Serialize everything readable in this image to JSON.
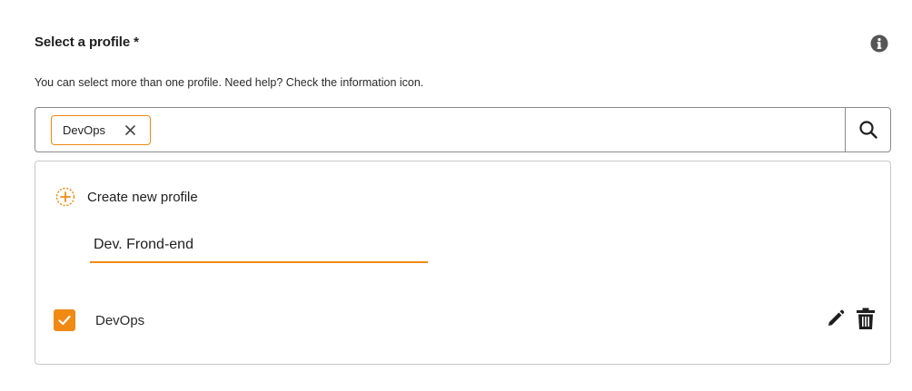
{
  "header": {
    "title": "Select a profile *",
    "subtitle": "You can select more than one profile. Need help? Check the information icon."
  },
  "selector": {
    "chips": [
      {
        "label": "DevOps"
      }
    ],
    "icons": {
      "chip_remove": "close-icon",
      "search": "search-icon",
      "info": "info-icon"
    }
  },
  "panel": {
    "create_label": "Create new profile",
    "new_profile_value": "Dev. Frond-end",
    "profiles": [
      {
        "label": "DevOps",
        "checked": true
      }
    ],
    "icons": {
      "create": "plus-circle-icon",
      "edit": "pencil-icon",
      "delete": "trash-icon",
      "check": "check-icon"
    }
  },
  "colors": {
    "accent": "#f08a12",
    "text": "#222222",
    "border": "#8a8a8a",
    "panel_border": "#c8c8c8"
  }
}
